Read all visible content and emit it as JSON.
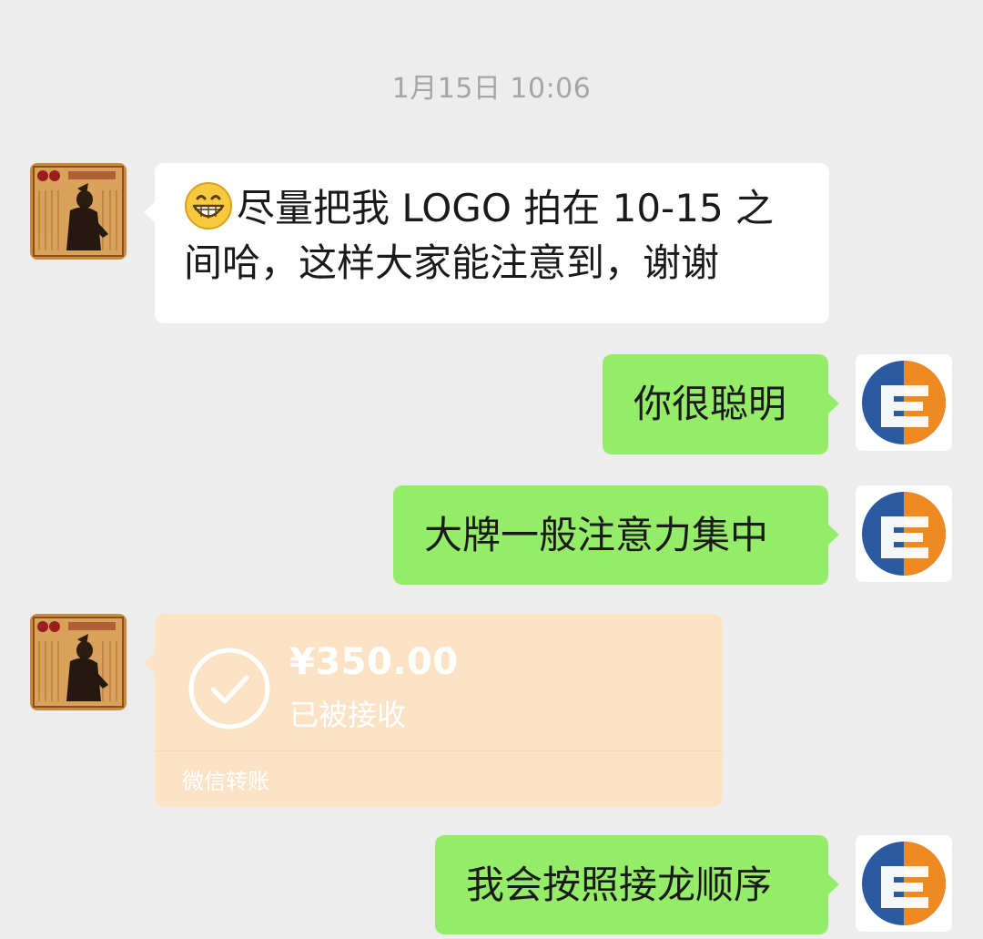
{
  "chat": {
    "timestamp": "1月15日 10:06",
    "messages": [
      {
        "sender": "other",
        "emoji": "grinning-face-icon",
        "line1": "尽量把我 LOGO  拍在 10-15 之",
        "line2": "间哈，这样大家能注意到，谢谢"
      },
      {
        "sender": "self",
        "text": "你很聪明"
      },
      {
        "sender": "self",
        "text": "大牌一般注意力集中"
      },
      {
        "sender": "other",
        "type": "transfer",
        "amount": "¥350.00",
        "status": "已被接收",
        "footer": "微信转账"
      },
      {
        "sender": "self",
        "text": "我会按照接龙顺序"
      }
    ]
  },
  "colors": {
    "background": "#ededed",
    "bubble_in": "#ffffff",
    "bubble_out": "#95ec69",
    "transfer": "#fde3c6",
    "logo_blue": "#2b5aa3",
    "logo_orange": "#ef8a22"
  }
}
